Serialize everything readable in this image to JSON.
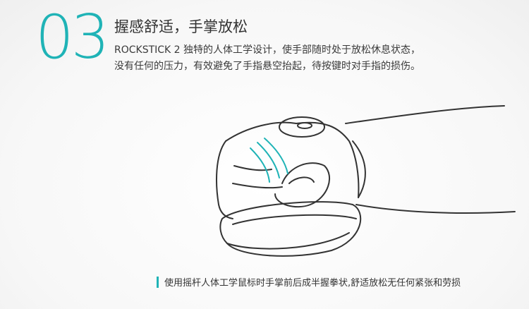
{
  "colors": {
    "accent": "#1fb3b6",
    "text": "#333333",
    "line": "#333333",
    "motion": "#1fb3b6"
  },
  "section": {
    "number": "03",
    "headline": "握感舒适，手掌放松",
    "description_lines": [
      "ROCKSTICK 2 独特的人体工学设计，使手部随时处于放松休息状态，",
      "没有任何的压力，有效避免了手指悬空抬起，待按键时对手指的损伤。"
    ]
  },
  "illustration": {
    "icon": "hand-on-joystick-icon"
  },
  "caption": {
    "text": "使用摇杆人体工学鼠标时手掌前后成半握拳状,舒适放松无任何紧张和劳损"
  }
}
